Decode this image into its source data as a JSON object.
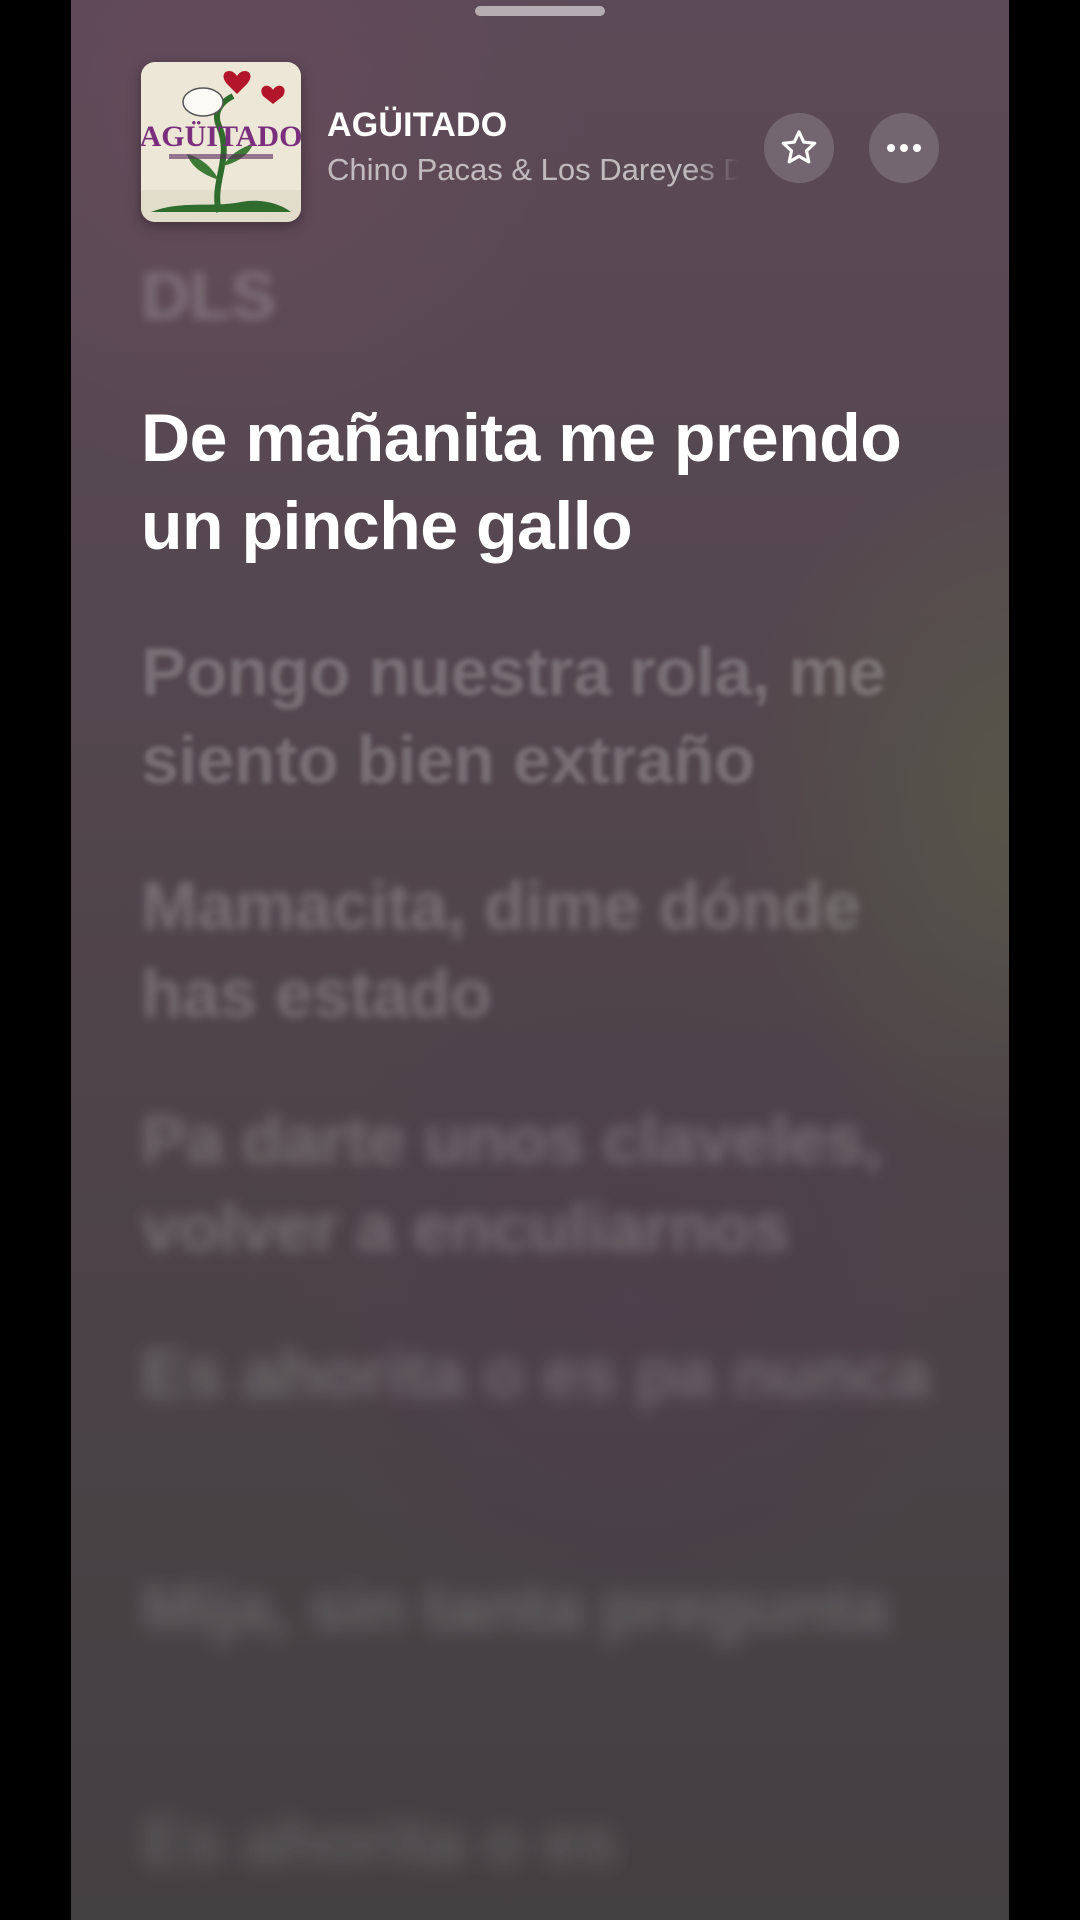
{
  "now_playing": {
    "title": "AGÜITADO",
    "artist": "Chino Pacas & Los Dareyes De La Sierra",
    "artwork_label": "AGÜITADO"
  },
  "actions": {
    "favorite_icon": "star-icon",
    "more_icon": "ellipsis-icon"
  },
  "lyrics": {
    "previous": "DLS",
    "active": "De mañanita me prendo un pinche gallo",
    "upcoming": [
      "Pongo nuestra rola, me siento bien extraño",
      "Mamacita, dime dónde has estado",
      "Pa darte unos claveles, volver a enculiarnos",
      "Es ahorita o es pa nunca",
      "Mija, sin tanta pregunta",
      "Es ahorita o es"
    ]
  },
  "colors": {
    "active_lyric": "#ffffff",
    "background": "#4d4348"
  }
}
